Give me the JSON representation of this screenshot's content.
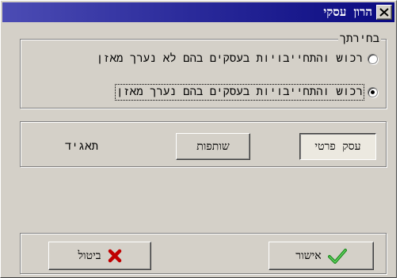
{
  "window": {
    "title": "הרון עסקי",
    "colors": {
      "titlebar": "#0a0a80",
      "face": "#d4d0c8"
    }
  },
  "selection_group": {
    "legend": "בחירתך",
    "options": [
      {
        "label": "רכוש והתחייבויות בעסקים בהם לא נערך מאזן",
        "checked": false
      },
      {
        "label": "רכוש והתחייבויות בעסקים בהם נערך מאזן",
        "checked": true
      }
    ]
  },
  "business_type": {
    "private_label": "עסק פרטי",
    "partnership_label": "שותפות",
    "corporation_label": "תאגיד"
  },
  "footer": {
    "ok_label": "אישור",
    "cancel_label": "ביטול",
    "icons": {
      "ok": "checkmark-icon",
      "cancel": "red-x-icon"
    }
  }
}
